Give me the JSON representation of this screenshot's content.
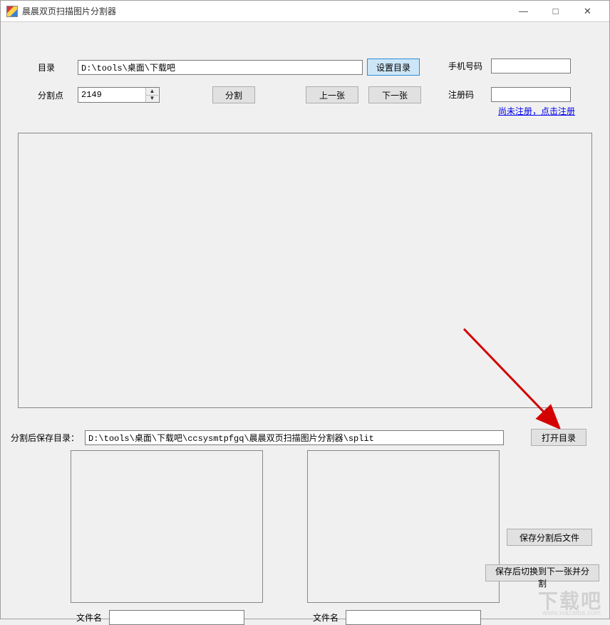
{
  "window": {
    "title": "晨晨双页扫描图片分割器"
  },
  "labels": {
    "directory": "目录",
    "splitPoint": "分割点",
    "phone": "手机号码",
    "regCode": "注册码",
    "saveDir": "分割后保存目录：",
    "filename": "文件名"
  },
  "inputs": {
    "directory": "D:\\tools\\桌面\\下载吧",
    "splitPoint": "2149",
    "phone": "",
    "regCode": "",
    "saveDir": "D:\\tools\\桌面\\下载吧\\ccsysmtpfgq\\晨晨双页扫描图片分割器\\split",
    "filenameA": "",
    "filenameB": ""
  },
  "buttons": {
    "setDirectory": "设置目录",
    "split": "分割",
    "prev": "上一张",
    "next": "下一张",
    "openDir": "打开目录",
    "saveSplit": "保存分割后文件",
    "saveNext": "保存后切换到下一张并分割"
  },
  "links": {
    "register": "尚未注册，点击注册"
  },
  "watermark": {
    "main": "下载吧",
    "sub": "www.xiazaiba.com"
  }
}
